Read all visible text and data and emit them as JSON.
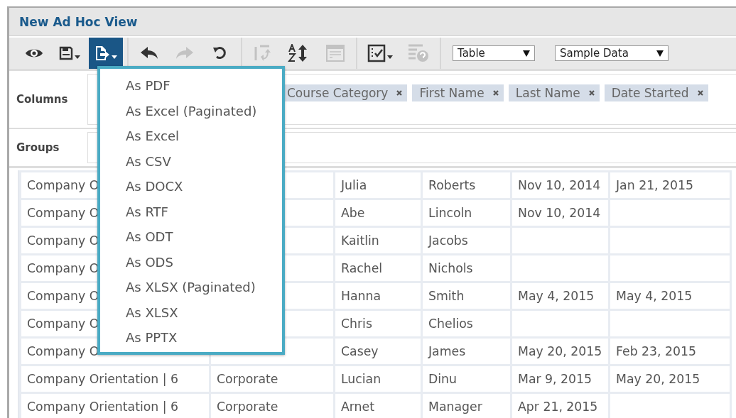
{
  "window": {
    "title": "New Ad Hoc View"
  },
  "toolbar": {
    "groups": [
      [
        {
          "kind": "eye",
          "disabled": false,
          "selected": false,
          "dropdown": false
        },
        {
          "kind": "save",
          "disabled": false,
          "selected": false,
          "dropdown": true
        },
        {
          "kind": "export",
          "disabled": false,
          "selected": true,
          "dropdown": true
        }
      ],
      [
        {
          "kind": "undo",
          "disabled": false,
          "selected": false,
          "dropdown": false
        },
        {
          "kind": "redo",
          "disabled": true,
          "selected": false,
          "dropdown": false
        },
        {
          "kind": "undo-all",
          "disabled": false,
          "selected": false,
          "dropdown": false
        }
      ],
      [
        {
          "kind": "switch",
          "disabled": true,
          "selected": false,
          "dropdown": false
        },
        {
          "kind": "sort",
          "disabled": false,
          "selected": false,
          "dropdown": false
        },
        {
          "kind": "layout",
          "disabled": true,
          "selected": false,
          "dropdown": false
        }
      ],
      [
        {
          "kind": "checklist",
          "disabled": false,
          "selected": false,
          "dropdown": true
        },
        {
          "kind": "help-list",
          "disabled": true,
          "selected": false,
          "dropdown": false
        }
      ]
    ],
    "selects": [
      {
        "value": "Table"
      },
      {
        "value": "Sample Data"
      }
    ]
  },
  "export_menu": {
    "items": [
      "As PDF",
      "As Excel (Paginated)",
      "As Excel",
      "As CSV",
      "As DOCX",
      "As RTF",
      "As ODT",
      "As ODS",
      "As XLSX (Paginated)",
      "As XLSX",
      "As PPTX"
    ]
  },
  "columns_panel": {
    "label": "Columns",
    "chips": [
      "Course Category",
      "First Name",
      "Last Name",
      "Date Started"
    ]
  },
  "groups_panel": {
    "label": "Groups"
  },
  "table": {
    "rows": [
      [
        "Company O",
        null,
        "Julia",
        "Roberts",
        "Nov 10, 2014",
        "Jan 21, 2015"
      ],
      [
        "Company O",
        null,
        "Abe",
        "Lincoln",
        "Nov 10, 2014",
        null
      ],
      [
        "Company O",
        null,
        "Kaitlin",
        "Jacobs",
        null,
        null
      ],
      [
        "Company O",
        null,
        "Rachel",
        "Nichols",
        null,
        null
      ],
      [
        "Company O",
        null,
        "Hanna",
        "Smith",
        "May 4, 2015",
        "May 4, 2015"
      ],
      [
        "Company O",
        null,
        "Chris",
        "Chelios",
        null,
        null
      ],
      [
        "Company O",
        null,
        "Casey",
        "James",
        "May 20, 2015",
        "Feb 23, 2015"
      ],
      [
        "Company Orientation | 6",
        "Corporate",
        "Lucian",
        "Dinu",
        "Mar 9, 2015",
        "May 20, 2015"
      ],
      [
        "Company Orientation | 6",
        "Corporate",
        "Arnet",
        "Manager",
        "Apr 21, 2015",
        null
      ]
    ]
  }
}
